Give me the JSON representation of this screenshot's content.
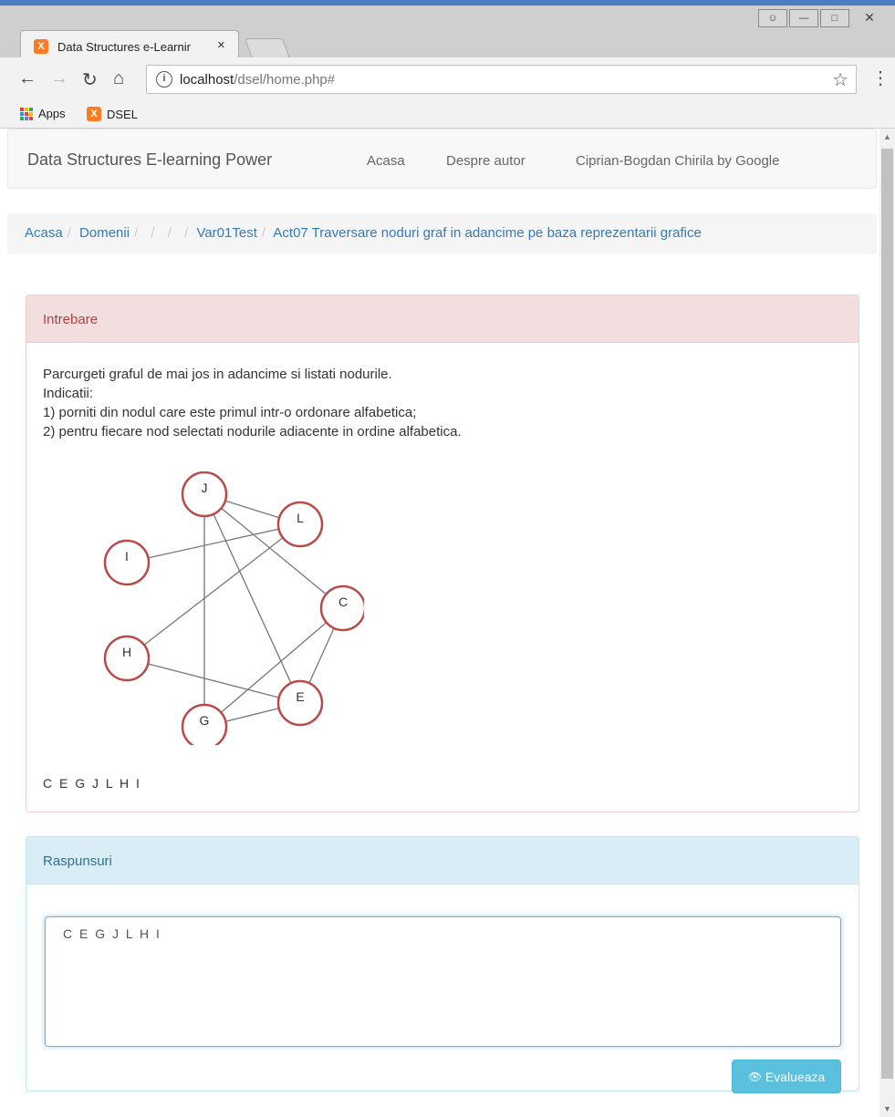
{
  "browser": {
    "tab_title": "Data Structures e-Learnir",
    "tab_favicon": "X",
    "tab_close": "×",
    "url_host": "localhost",
    "url_path": "/dsel/home.php#",
    "bookmarks": [
      {
        "label": "Apps"
      },
      {
        "label": "DSEL"
      }
    ]
  },
  "navbar": {
    "brand": "Data Structures E-learning Power",
    "links": [
      "Acasa",
      "Despre autor",
      "Ciprian-Bogdan Chirila by Google"
    ]
  },
  "breadcrumb": {
    "items": [
      "Acasa",
      "Domenii",
      "",
      "",
      "",
      "Var01Test",
      "Act07 Traversare noduri graf in adancime pe baza reprezentarii grafice"
    ]
  },
  "question_panel": {
    "title": "Intrebare",
    "lines": [
      "Parcurgeti graful de mai jos in adancime si listati nodurile.",
      "Indicatii:",
      "1) porniti din nodul care este primul intr-o ordonare alfabetica;",
      "2) pentru fiecare nod selectati nodurile adiacente in ordine alfabetica."
    ],
    "graph": {
      "nodes": [
        "J",
        "L",
        "I",
        "C",
        "H",
        "E",
        "G"
      ],
      "edges": [
        [
          "J",
          "L"
        ],
        [
          "J",
          "C"
        ],
        [
          "J",
          "E"
        ],
        [
          "J",
          "G"
        ],
        [
          "I",
          "L"
        ],
        [
          "H",
          "L"
        ],
        [
          "H",
          "E"
        ],
        [
          "C",
          "E"
        ],
        [
          "C",
          "G"
        ],
        [
          "G",
          "E"
        ]
      ],
      "node_color": "#b94a48"
    },
    "answer_text": "C E G J L H I"
  },
  "answers_panel": {
    "title": "Raspunsuri",
    "textarea_value": "C E G J L H I",
    "evaluate_label": "Evalueaza"
  },
  "colors": {
    "link": "#337ab7",
    "danger_bg": "#f2dede",
    "info_bg": "#d9edf7",
    "button": "#5bc0de"
  }
}
